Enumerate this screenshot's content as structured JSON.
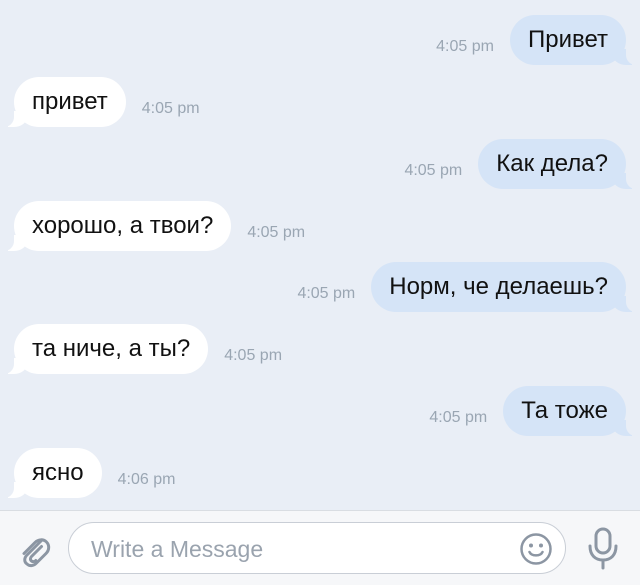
{
  "messages": [
    {
      "direction": "out",
      "text": "Привет",
      "time": "4:05 pm"
    },
    {
      "direction": "in",
      "text": "привет",
      "time": "4:05 pm"
    },
    {
      "direction": "out",
      "text": "Как дела?",
      "time": "4:05 pm"
    },
    {
      "direction": "in",
      "text": "хорошо, а твои?",
      "time": "4:05 pm"
    },
    {
      "direction": "out",
      "text": "Норм, че делаешь?",
      "time": "4:05 pm"
    },
    {
      "direction": "in",
      "text": "та ниче, а ты?",
      "time": "4:05 pm"
    },
    {
      "direction": "out",
      "text": "Та тоже",
      "time": "4:05 pm"
    },
    {
      "direction": "in",
      "text": "ясно",
      "time": "4:06 pm"
    }
  ],
  "composer": {
    "placeholder": "Write a Message",
    "value": "",
    "icons": {
      "attach": "paperclip-icon",
      "emoji": "emoji-icon",
      "mic": "microphone-icon"
    }
  },
  "colors": {
    "background": "#e9eef6",
    "incoming_bubble": "#ffffff",
    "outgoing_bubble": "#d5e4f7",
    "timestamp": "#9aa6b3",
    "icon": "#8c96a3"
  }
}
